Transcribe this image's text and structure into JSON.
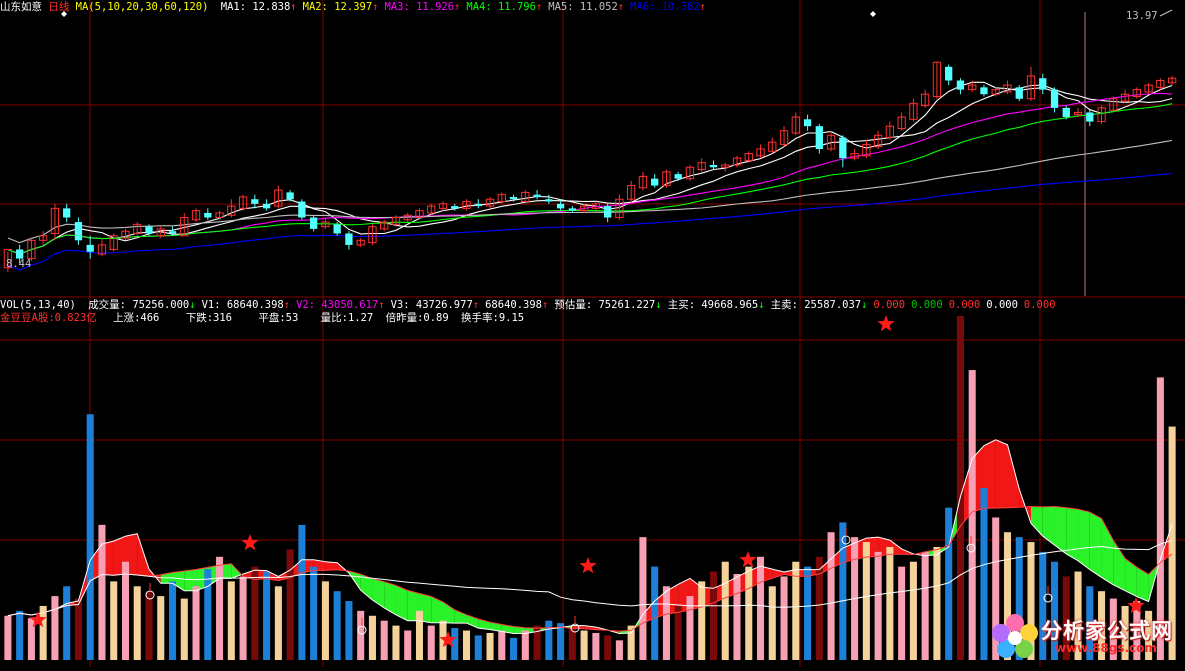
{
  "header": {
    "stock_name": "山东如意",
    "period": "日线",
    "ma_def": "MA(5,10,20,30,60,120)",
    "ma_values": [
      {
        "label": "MA1: 12.838",
        "arrow": "↑",
        "color": "#ffffff"
      },
      {
        "label": "MA2: 12.397",
        "arrow": "↑",
        "color": "#ffff00"
      },
      {
        "label": "MA3: 11.926",
        "arrow": "↑",
        "color": "#ff00ff"
      },
      {
        "label": "MA4: 11.796",
        "arrow": "↑",
        "color": "#00ff00"
      },
      {
        "label": "MA5: 11.052",
        "arrow": "↑",
        "color": "#c0c0c0"
      },
      {
        "label": "MA6: 10.382",
        "arrow": "↑",
        "color": "#0000ff"
      }
    ]
  },
  "price_labels": {
    "high": "13.97",
    "low": "8.44"
  },
  "volume_header": {
    "def": "VOL(5,13,40)",
    "items": [
      {
        "text": "成交量: 75256.000",
        "arrow": "↓",
        "color": "#ffffff"
      },
      {
        "text": "V1: 68640.398",
        "arrow": "↑",
        "color": "#ffffff"
      },
      {
        "text": "V2: 43050.617",
        "arrow": "↑",
        "color": "#ff00ff"
      },
      {
        "text": "V3: 43726.977",
        "arrow": "↑",
        "color": "#ffffff"
      },
      {
        "text": "68640.398",
        "arrow": "↑",
        "color": "#ffffff"
      },
      {
        "text": "预估量: 75261.227",
        "arrow": "↓",
        "color": "#ffffff"
      },
      {
        "text": "主买: 49668.965",
        "arrow": "↓",
        "color": "#ffffff"
      },
      {
        "text": "主卖: 25587.037",
        "arrow": "↓",
        "color": "#ffffff"
      },
      {
        "text": "0.000",
        "arrow": "",
        "color": "#ff3030"
      },
      {
        "text": "0.000",
        "arrow": "",
        "color": "#00c000"
      },
      {
        "text": "0.000",
        "arrow": "",
        "color": "#ff3030"
      },
      {
        "text": "0.000",
        "arrow": "",
        "color": "#ffffff"
      },
      {
        "text": "0.000",
        "arrow": "",
        "color": "#ff3030"
      }
    ]
  },
  "stats": {
    "a_share": "金豆豆A股:0.823亿",
    "up": "上涨:466",
    "down": "下跌:316",
    "flat": "平盘:53",
    "vol_ratio": "量比:1.27",
    "prev_ratio": "倍昨量:0.89",
    "turnover": "换手率:9.15"
  },
  "watermark": {
    "name": "分析家公式网",
    "url": "www.88gs.com"
  },
  "colors": {
    "up": "#ff3030",
    "down": "#54ffff",
    "grid": "#800000",
    "vol_light": "#f7a0b4",
    "vol_blue": "#1c7fd8",
    "vol_tan": "#f3d39a",
    "vol_dark": "#7a0a0a"
  },
  "chart_data": [
    {
      "type": "candlestick",
      "title": "",
      "ylim": [
        8.2,
        14.2
      ],
      "x_count": 100,
      "candles": [
        [
          8.6,
          9.0,
          8.5,
          8.95
        ],
        [
          9.0,
          8.8,
          8.7,
          9.1
        ],
        [
          8.8,
          9.2,
          8.75,
          9.25
        ],
        [
          9.2,
          9.3,
          9.1,
          9.4
        ],
        [
          9.35,
          9.9,
          9.2,
          10.0
        ],
        [
          9.9,
          9.7,
          9.6,
          10.0
        ],
        [
          9.6,
          9.2,
          9.1,
          9.7
        ],
        [
          9.1,
          8.95,
          8.8,
          9.3
        ],
        [
          8.9,
          9.1,
          8.85,
          9.2
        ],
        [
          9.0,
          9.3,
          8.95,
          9.35
        ],
        [
          9.25,
          9.4,
          9.2,
          9.45
        ],
        [
          9.35,
          9.55,
          9.3,
          9.6
        ],
        [
          9.5,
          9.35,
          9.3,
          9.55
        ],
        [
          9.3,
          9.45,
          9.25,
          9.5
        ],
        [
          9.4,
          9.35,
          9.3,
          9.5
        ],
        [
          9.3,
          9.7,
          9.3,
          9.8
        ],
        [
          9.65,
          9.85,
          9.6,
          9.9
        ],
        [
          9.8,
          9.7,
          9.65,
          9.9
        ],
        [
          9.7,
          9.8,
          9.65,
          9.85
        ],
        [
          9.75,
          9.95,
          9.7,
          10.1
        ],
        [
          9.9,
          10.15,
          9.85,
          10.2
        ],
        [
          10.1,
          10.0,
          9.9,
          10.2
        ],
        [
          10.0,
          9.9,
          9.85,
          10.1
        ],
        [
          9.95,
          10.3,
          9.9,
          10.4
        ],
        [
          10.25,
          10.1,
          10.05,
          10.3
        ],
        [
          10.05,
          9.7,
          9.65,
          10.1
        ],
        [
          9.7,
          9.45,
          9.4,
          9.75
        ],
        [
          9.5,
          9.6,
          9.45,
          9.7
        ],
        [
          9.55,
          9.35,
          9.3,
          9.6
        ],
        [
          9.35,
          9.1,
          9.0,
          9.4
        ],
        [
          9.1,
          9.2,
          9.05,
          9.25
        ],
        [
          9.15,
          9.5,
          9.1,
          9.55
        ],
        [
          9.45,
          9.6,
          9.4,
          9.65
        ],
        [
          9.55,
          9.7,
          9.5,
          9.75
        ],
        [
          9.65,
          9.75,
          9.6,
          9.8
        ],
        [
          9.7,
          9.85,
          9.65,
          9.9
        ],
        [
          9.8,
          9.95,
          9.75,
          10.0
        ],
        [
          9.9,
          10.0,
          9.85,
          10.05
        ],
        [
          9.95,
          9.9,
          9.85,
          10.0
        ],
        [
          9.9,
          10.05,
          9.85,
          10.1
        ],
        [
          10.0,
          9.95,
          9.9,
          10.1
        ],
        [
          9.95,
          10.1,
          9.9,
          10.15
        ],
        [
          10.05,
          10.2,
          10.0,
          10.25
        ],
        [
          10.15,
          10.1,
          10.05,
          10.2
        ],
        [
          10.05,
          10.25,
          10.0,
          10.3
        ],
        [
          10.2,
          10.15,
          10.1,
          10.3
        ],
        [
          10.1,
          10.05,
          10.0,
          10.2
        ],
        [
          10.0,
          9.9,
          9.85,
          10.1
        ],
        [
          9.9,
          9.85,
          9.8,
          9.95
        ],
        [
          9.85,
          9.95,
          9.8,
          10.0
        ],
        [
          9.9,
          10.0,
          9.85,
          10.05
        ],
        [
          9.95,
          9.7,
          9.6,
          10.0
        ],
        [
          9.7,
          10.1,
          9.65,
          10.2
        ],
        [
          10.1,
          10.4,
          10.0,
          10.5
        ],
        [
          10.35,
          10.6,
          10.3,
          10.7
        ],
        [
          10.55,
          10.4,
          10.35,
          10.65
        ],
        [
          10.4,
          10.7,
          10.35,
          10.75
        ],
        [
          10.65,
          10.55,
          10.5,
          10.7
        ],
        [
          10.55,
          10.8,
          10.5,
          10.85
        ],
        [
          10.75,
          10.9,
          10.7,
          11.0
        ],
        [
          10.85,
          10.8,
          10.75,
          10.95
        ],
        [
          10.8,
          10.85,
          10.7,
          10.9
        ],
        [
          10.85,
          11.0,
          10.8,
          11.05
        ],
        [
          10.95,
          11.1,
          10.9,
          11.15
        ],
        [
          11.05,
          11.2,
          11.0,
          11.3
        ],
        [
          11.15,
          11.35,
          11.1,
          11.45
        ],
        [
          11.3,
          11.6,
          11.25,
          11.7
        ],
        [
          11.55,
          11.9,
          11.5,
          12.0
        ],
        [
          11.85,
          11.7,
          11.6,
          11.95
        ],
        [
          11.7,
          11.2,
          11.1,
          11.75
        ],
        [
          11.2,
          11.5,
          11.15,
          11.6
        ],
        [
          11.45,
          11.0,
          10.8,
          11.5
        ],
        [
          11.0,
          11.1,
          10.95,
          11.2
        ],
        [
          11.05,
          11.3,
          11.0,
          11.4
        ],
        [
          11.25,
          11.5,
          11.2,
          11.6
        ],
        [
          11.45,
          11.7,
          11.4,
          11.8
        ],
        [
          11.65,
          11.9,
          11.6,
          12.0
        ],
        [
          11.85,
          12.2,
          11.8,
          12.3
        ],
        [
          12.15,
          12.4,
          12.1,
          12.5
        ],
        [
          12.35,
          13.1,
          12.3,
          13.1
        ],
        [
          13.0,
          12.7,
          12.6,
          13.05
        ],
        [
          12.7,
          12.5,
          12.4,
          12.75
        ],
        [
          12.5,
          12.6,
          12.45,
          12.7
        ],
        [
          12.55,
          12.4,
          12.35,
          12.6
        ],
        [
          12.4,
          12.5,
          12.35,
          12.55
        ],
        [
          12.45,
          12.6,
          12.4,
          12.7
        ],
        [
          12.55,
          12.3,
          12.25,
          12.6
        ],
        [
          12.3,
          12.8,
          12.25,
          13.0
        ],
        [
          12.75,
          12.5,
          12.4,
          12.85
        ],
        [
          12.5,
          12.1,
          12.0,
          12.55
        ],
        [
          12.1,
          11.9,
          11.85,
          12.15
        ],
        [
          11.95,
          12.0,
          11.9,
          12.1
        ],
        [
          12.0,
          11.8,
          11.7,
          12.05
        ],
        [
          11.8,
          12.1,
          11.75,
          12.15
        ],
        [
          12.05,
          12.3,
          12.0,
          12.35
        ],
        [
          12.25,
          12.4,
          12.2,
          12.5
        ],
        [
          12.35,
          12.5,
          12.3,
          12.55
        ],
        [
          12.45,
          12.6,
          12.4,
          12.65
        ],
        [
          12.55,
          12.7,
          12.5,
          12.75
        ],
        [
          12.65,
          12.75,
          12.6,
          12.8
        ]
      ]
    },
    {
      "type": "bar",
      "title": "",
      "ylim": [
        0,
        140
      ],
      "x_count": 100,
      "values": [
        18,
        20,
        17,
        22,
        26,
        30,
        25,
        100,
        55,
        32,
        40,
        30,
        28,
        26,
        32,
        25,
        30,
        37,
        42,
        32,
        34,
        38,
        36,
        30,
        45,
        55,
        38,
        32,
        28,
        24,
        20,
        18,
        16,
        14,
        12,
        20,
        14,
        16,
        13,
        12,
        10,
        11,
        12,
        9,
        12,
        14,
        16,
        15,
        13,
        12,
        11,
        10,
        8,
        14,
        50,
        38,
        30,
        22,
        26,
        32,
        36,
        40,
        35,
        38,
        42,
        30,
        34,
        40,
        38,
        42,
        52,
        56,
        50,
        48,
        44,
        46,
        38,
        40,
        44,
        46,
        62,
        140,
        118,
        70,
        58,
        52,
        50,
        48,
        44,
        40,
        34,
        36,
        30,
        28,
        25,
        22,
        24,
        20,
        115,
        95
      ]
    }
  ]
}
